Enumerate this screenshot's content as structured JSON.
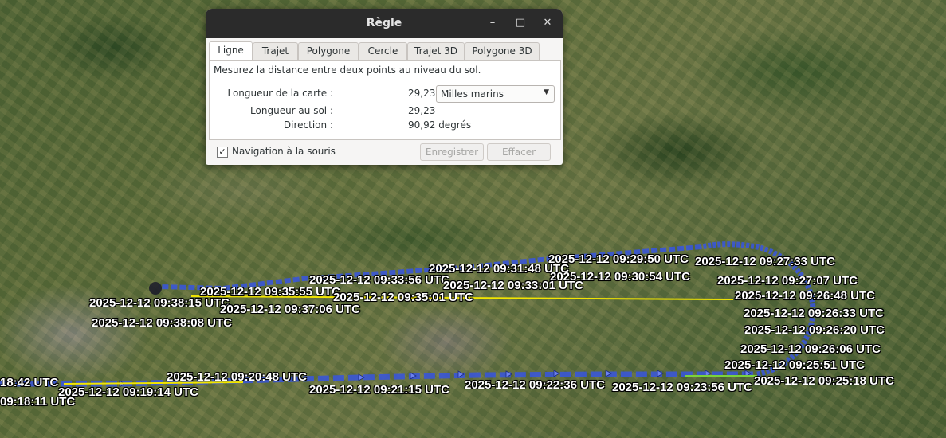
{
  "dialog": {
    "title": "Règle",
    "tabs": [
      "Ligne",
      "Trajet",
      "Polygone",
      "Cercle",
      "Trajet 3D",
      "Polygone 3D"
    ],
    "active_tab": "Ligne",
    "description": "Mesurez la distance entre deux points au niveau du sol.",
    "map_length_label": "Longueur de la carte :",
    "map_length_value": "29,23",
    "unit_selected": "Milles marins",
    "ground_length_label": "Longueur au sol :",
    "ground_length_value": "29,23",
    "direction_label": "Direction :",
    "direction_value": "90,92",
    "direction_unit": "degrés",
    "mouse_nav_label": "Navigation à la souris",
    "mouse_nav_checked": true,
    "save_label": "Enregistrer",
    "clear_label": "Effacer"
  },
  "colors": {
    "measure_line": "#f2e600",
    "track": "#3a56d6",
    "titlebar": "#2b2b2b"
  },
  "map_labels": [
    "2025-12-12 09:29:50 UTC",
    "2025-12-12 09:27:33 UTC",
    "2025-12-12 09:31:48 UTC",
    "2025-12-12 09:30:54 UTC",
    "2025-12-12 09:27:07 UTC",
    "2025-12-12 09:33:56 UTC",
    "2025-12-12 09:33:01 UTC",
    "2025-12-12 09:35:55 UTC",
    "2025-12-12 09:35:01 UTC",
    "2025-12-12 09:26:48 UTC",
    "2025-12-12 09:38:15 UTC",
    "2025-12-12 09:37:06 UTC",
    "2025-12-12 09:26:33 UTC",
    "2025-12-12 09:38:08 UTC",
    "2025-12-12 09:26:20 UTC",
    "2025-12-12 09:26:06 UTC",
    "2025-12-12 09:25:51 UTC",
    "2025-12-12 09:20:48 UTC",
    "2025-12-12 09:25:18 UTC",
    "18:42 UTC",
    "2025-12-12 09:22:36 UTC",
    "2025-12-12 09:21:15 UTC",
    "2025-12-12 09:23:56 UTC",
    "2025-12-12 09:19:14 UTC",
    "09:18:11 UTC"
  ]
}
